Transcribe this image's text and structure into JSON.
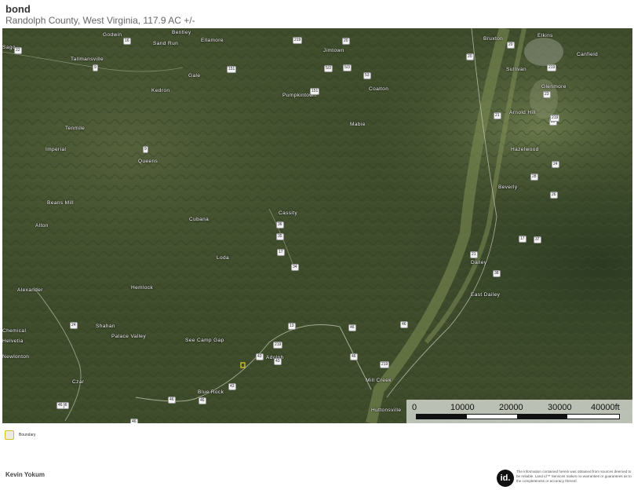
{
  "header": {
    "title": "bond",
    "subtitle": "Randolph County, West Virginia, 117.9 AC +/-"
  },
  "map": {
    "places": [
      "Godwin",
      "Bentley",
      "Sand Run",
      "Ellamore",
      "Tallmansville",
      "Gale",
      "Kedron",
      "Jimtown",
      "Pumpkintown",
      "Coalton",
      "Bruxton",
      "Elkins",
      "Canfield",
      "Sullivan",
      "Glenmore",
      "Arnold Hill",
      "Mabie",
      "Tenmile",
      "Imperial",
      "Queens",
      "Hazelwood",
      "Beverly",
      "Beans Mill",
      "Alton",
      "Cubana",
      "Cassity",
      "Loda",
      "Dailey",
      "East Dailey",
      "Alexander",
      "Hemlock",
      "Shahan",
      "Palace Valley",
      "See Camp Gap",
      "Adolph",
      "Chemical",
      "Helvetia",
      "Newlonton",
      "Czar",
      "Blue Rock",
      "Mill Creek",
      "Huttonsville",
      "Sago"
    ],
    "shields": [
      "16",
      "22",
      "9",
      "151",
      "5/3",
      "5/3",
      "53",
      "151",
      "20",
      "20",
      "219",
      "23",
      "21",
      "20",
      "219",
      "28",
      "24",
      "26",
      "17",
      "9",
      "36",
      "35",
      "34",
      "21",
      "38",
      "37",
      "24",
      "13",
      "46",
      "46",
      "219",
      "219",
      "43",
      "43",
      "43",
      "46",
      "46",
      "46",
      "46",
      "46",
      "219",
      "20",
      "17",
      "46"
    ]
  },
  "scale": {
    "labels": [
      "0",
      "10000",
      "20000",
      "30000",
      "40000ft"
    ]
  },
  "legend": {
    "label": "Boundary"
  },
  "footer": {
    "author": "Kevin Yokum",
    "logo": "id.",
    "disclaimer": "The information contained herein was obtained from sources deemed to be reliable. Land id™ Services makes no warranties or guarantees as to the completeness or accuracy thereof."
  }
}
